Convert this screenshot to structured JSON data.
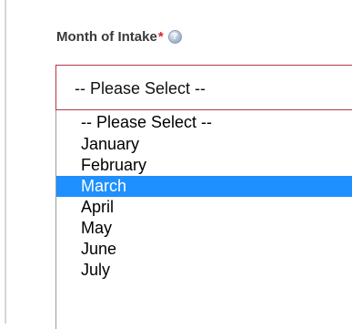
{
  "field": {
    "label": "Month of Intake",
    "required_marker": "*",
    "help_icon_glyph": "?",
    "help_icon": "help-circle-icon"
  },
  "select": {
    "current_value": "-- Please Select --"
  },
  "dropdown": {
    "options": [
      "-- Please Select --",
      "January",
      "February",
      "March",
      "April",
      "May",
      "June",
      "July"
    ],
    "highlighted_option": "March"
  },
  "colors": {
    "highlight": "#1e90ff",
    "required": "#d9252c",
    "invalid_border": "#b3364a"
  }
}
